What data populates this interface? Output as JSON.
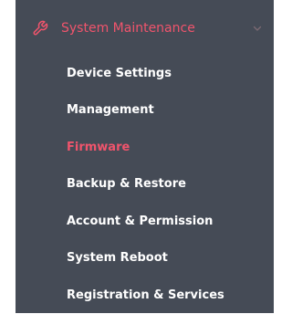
{
  "menu": {
    "header_icon": "wrench-icon",
    "header_label": "System Maintenance",
    "chevron_icon": "chevron-down-icon",
    "items": [
      {
        "label": "Device Settings",
        "active": false
      },
      {
        "label": "Management",
        "active": false
      },
      {
        "label": "Firmware",
        "active": true
      },
      {
        "label": "Backup & Restore",
        "active": false
      },
      {
        "label": "Account & Permission",
        "active": false
      },
      {
        "label": "System Reboot",
        "active": false
      },
      {
        "label": "Registration & Services",
        "active": false
      }
    ]
  },
  "colors": {
    "panel_background": "#454b56",
    "accent": "#f0546c",
    "text": "#ffffff",
    "chevron": "#7c6a73"
  }
}
